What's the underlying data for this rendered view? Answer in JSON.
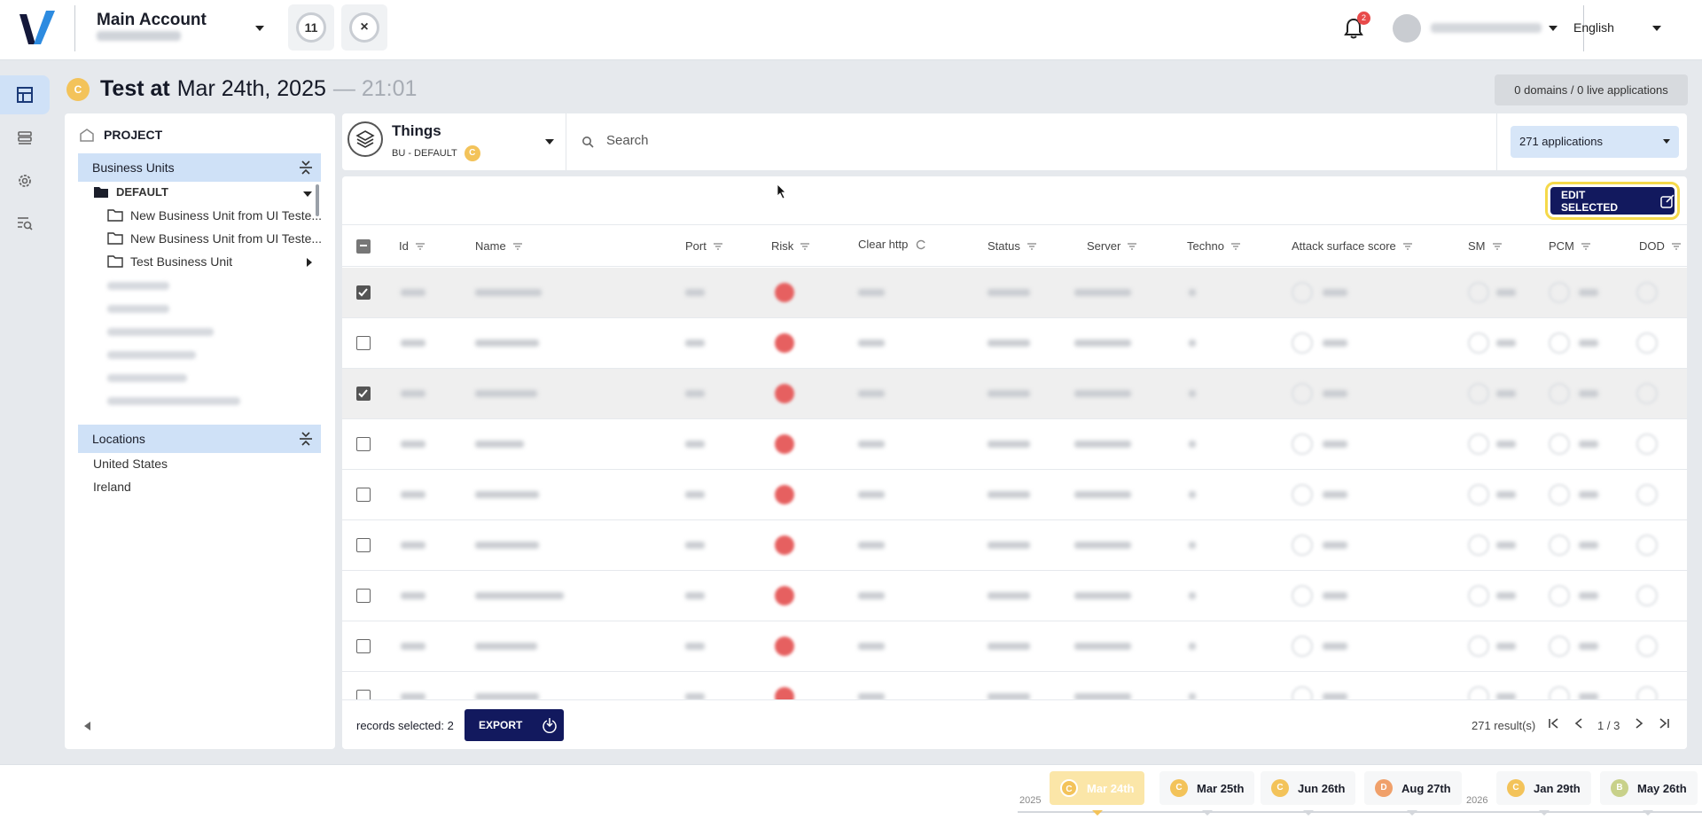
{
  "header": {
    "account_name": "Main Account",
    "counter_value": "11",
    "close_label": "×",
    "notification_count": "2",
    "language": "English"
  },
  "title": {
    "badge": "C",
    "prefix": "Test at",
    "date": "Mar 24th, 2025",
    "time": "— 21:01"
  },
  "domains_summary": "0 domains / 0 live applications",
  "left_panel": {
    "project_label": "PROJECT",
    "business_units_label": "Business Units",
    "default_folder": "DEFAULT",
    "tree_items": [
      "New Business Unit from UI Teste...",
      "New Business Unit from UI Teste...",
      "Test Business Unit"
    ],
    "locations_label": "Locations",
    "locations": [
      "United States",
      "Ireland"
    ]
  },
  "things_card": {
    "title": "Things",
    "subtitle": "BU - DEFAULT",
    "badge": "C",
    "search_placeholder": "Search",
    "applications_select": "271 applications"
  },
  "grid": {
    "edit_selected_label": "EDIT SELECTED",
    "columns": [
      "Id",
      "Name",
      "Port",
      "Risk",
      "Clear http",
      "Status",
      "Server",
      "Techno",
      "Attack surface score",
      "SM",
      "PCM",
      "DOD"
    ],
    "rows_checked": [
      true,
      false,
      true,
      false,
      false,
      false,
      false,
      false,
      false
    ],
    "records_selected_label": "records selected: 2",
    "export_label": "EXPORT",
    "results_label": "271 result(s)",
    "page_label": "1 / 3"
  },
  "timeline": {
    "years": [
      "2025",
      "2026"
    ],
    "snapshots": [
      {
        "badge": "C",
        "label": "Mar 24th",
        "color": "#f3c35a",
        "active": true
      },
      {
        "badge": "C",
        "label": "Mar 25th",
        "color": "#f3c35a",
        "active": false
      },
      {
        "badge": "C",
        "label": "Jun 26th",
        "color": "#f3c35a",
        "active": false
      },
      {
        "badge": "D",
        "label": "Aug 27th",
        "color": "#f0a06a",
        "active": false
      },
      {
        "badge": "C",
        "label": "Jan 29th",
        "color": "#f3c35a",
        "active": false
      },
      {
        "badge": "B",
        "label": "May 26th",
        "color": "#c8d18a",
        "active": false
      }
    ]
  },
  "colors": {
    "primary_navy": "#12195e",
    "accent_yellow": "#f3c35a",
    "selection_blue": "#cfe1f7",
    "risk_red": "#e66060"
  }
}
